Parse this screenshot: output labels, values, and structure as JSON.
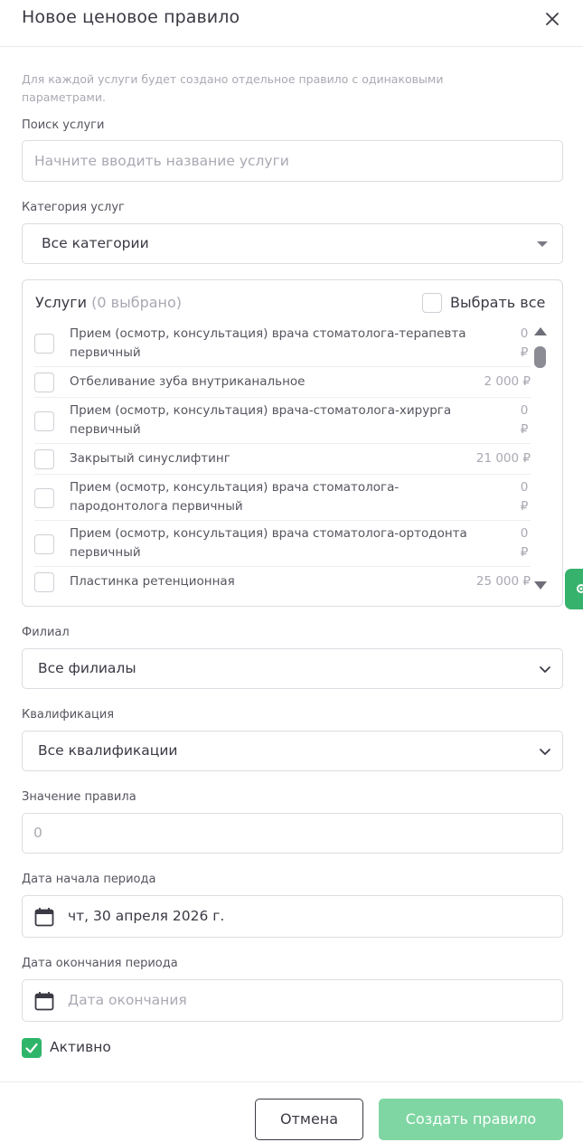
{
  "header": {
    "title": "Новое ценовое правило"
  },
  "hint": "Для каждой услуги будет создано отдельное правило с одинаковыми параметрами.",
  "search": {
    "label": "Поиск услуги",
    "placeholder": "Начните вводить название услуги"
  },
  "category": {
    "label": "Категория услуг",
    "value": "Все категории"
  },
  "services": {
    "title": "Услуги",
    "count": "(0 выбрано)",
    "select_all": "Выбрать все",
    "items": [
      {
        "name": "Прием (осмотр, консультация) врача стоматолога-терапевта первичный",
        "price": "0 ₽"
      },
      {
        "name": "Отбеливание зуба внутриканальное",
        "price": "2 000 ₽"
      },
      {
        "name": "Прием (осмотр, консультация) врача-стоматолога-хирурга первичный",
        "price": "0 ₽"
      },
      {
        "name": "Закрытый синуслифтинг",
        "price": "21 000 ₽"
      },
      {
        "name": "Прием (осмотр, консультация) врача стоматолога-пародонтолога первичный",
        "price": "0 ₽"
      },
      {
        "name": "Прием (осмотр, консультация) врача стоматолога-ортодонта первичный",
        "price": "0 ₽"
      },
      {
        "name": "Пластинка ретенционная",
        "price": "25 000 ₽"
      }
    ]
  },
  "branch": {
    "label": "Филиал",
    "value": "Все филиалы"
  },
  "qualification": {
    "label": "Квалификация",
    "value": "Все квалификации"
  },
  "rule_value": {
    "label": "Значение правила",
    "placeholder": "0"
  },
  "start_date": {
    "label": "Дата начала периода",
    "value": "чт, 30 апреля 2026 г."
  },
  "end_date": {
    "label": "Дата окончания периода",
    "placeholder": "Дата окончания"
  },
  "active": {
    "label": "Активно",
    "checked": true
  },
  "footer": {
    "cancel": "Отмена",
    "create": "Создать правило"
  },
  "colors": {
    "accent": "#2fb56a",
    "accent_disabled": "#7fd6a3",
    "text": "#3a3a44",
    "muted": "#a9a9b3"
  }
}
